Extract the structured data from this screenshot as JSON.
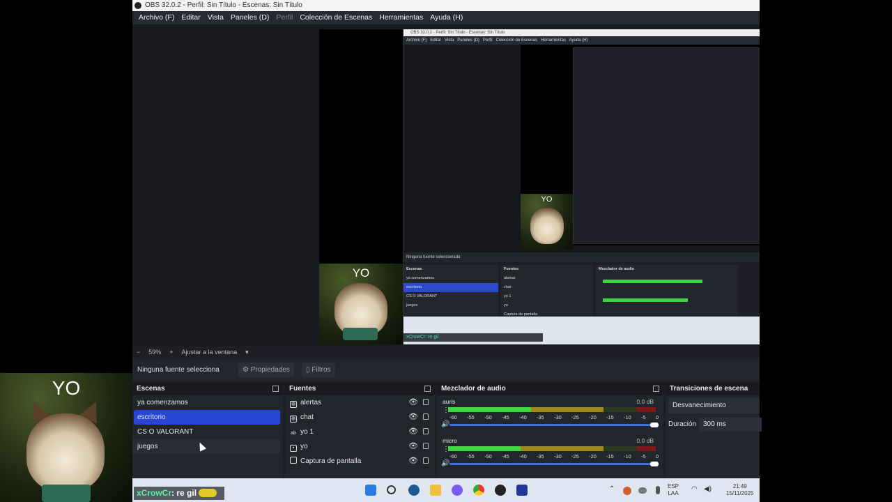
{
  "window": {
    "title": "OBS 32.0.2 - Perfil: Sin Título - Escenas: Sin Título"
  },
  "menu": [
    "Archivo (F)",
    "Editar",
    "Vista",
    "Paneles (D)",
    "Perfil",
    "Colección de Escenas",
    "Herramientas",
    "Ayuda (H)"
  ],
  "overlay": {
    "cam_label": "YO",
    "chat_user": "xCrowCr",
    "chat_text": ": re gil"
  },
  "preview_toolbar": {
    "zoom_out": "−",
    "zoom": "59%",
    "zoom_in": "+",
    "fit": "Ajustar a la ventana"
  },
  "source_bar": {
    "status": "Ninguna fuente seleccionada",
    "properties": "Propiedades",
    "filters": "Filtros"
  },
  "scenes": {
    "title": "Escenas",
    "items": [
      "ya comenzamos",
      "escritorio",
      "CS O VALORANT",
      "juegos"
    ],
    "selected": 1
  },
  "sources": {
    "title": "Fuentes",
    "items": [
      {
        "name": "alertas",
        "icon": "globe-icon"
      },
      {
        "name": "chat",
        "icon": "globe-icon"
      },
      {
        "name": "yo 1",
        "icon": "text-icon"
      },
      {
        "name": "yo",
        "icon": "image-icon"
      },
      {
        "name": "Captura de pantalla",
        "icon": "monitor-icon"
      }
    ]
  },
  "mixer": {
    "title": "Mezclador de audio",
    "ticks": [
      "-60",
      "-55",
      "-50",
      "-45",
      "-40",
      "-35",
      "-30",
      "-25",
      "-20",
      "-15",
      "-10",
      "-5",
      "0"
    ],
    "channels": [
      {
        "name": "auris",
        "db": "0.0 dB"
      },
      {
        "name": "micro",
        "db": "0.0 dB"
      }
    ]
  },
  "transitions": {
    "title": "Transiciones de escena",
    "type": "Desvanecimiento",
    "duration_label": "Duración",
    "duration": "300 ms"
  },
  "taskbar": {
    "lang": "ESP",
    "region": "LAA",
    "time": "21:49",
    "date": "15/11/2025"
  },
  "colors": {
    "accent": "#2845d4",
    "meter_green": "#3cd642",
    "chat_green": "#5ff0a9"
  }
}
